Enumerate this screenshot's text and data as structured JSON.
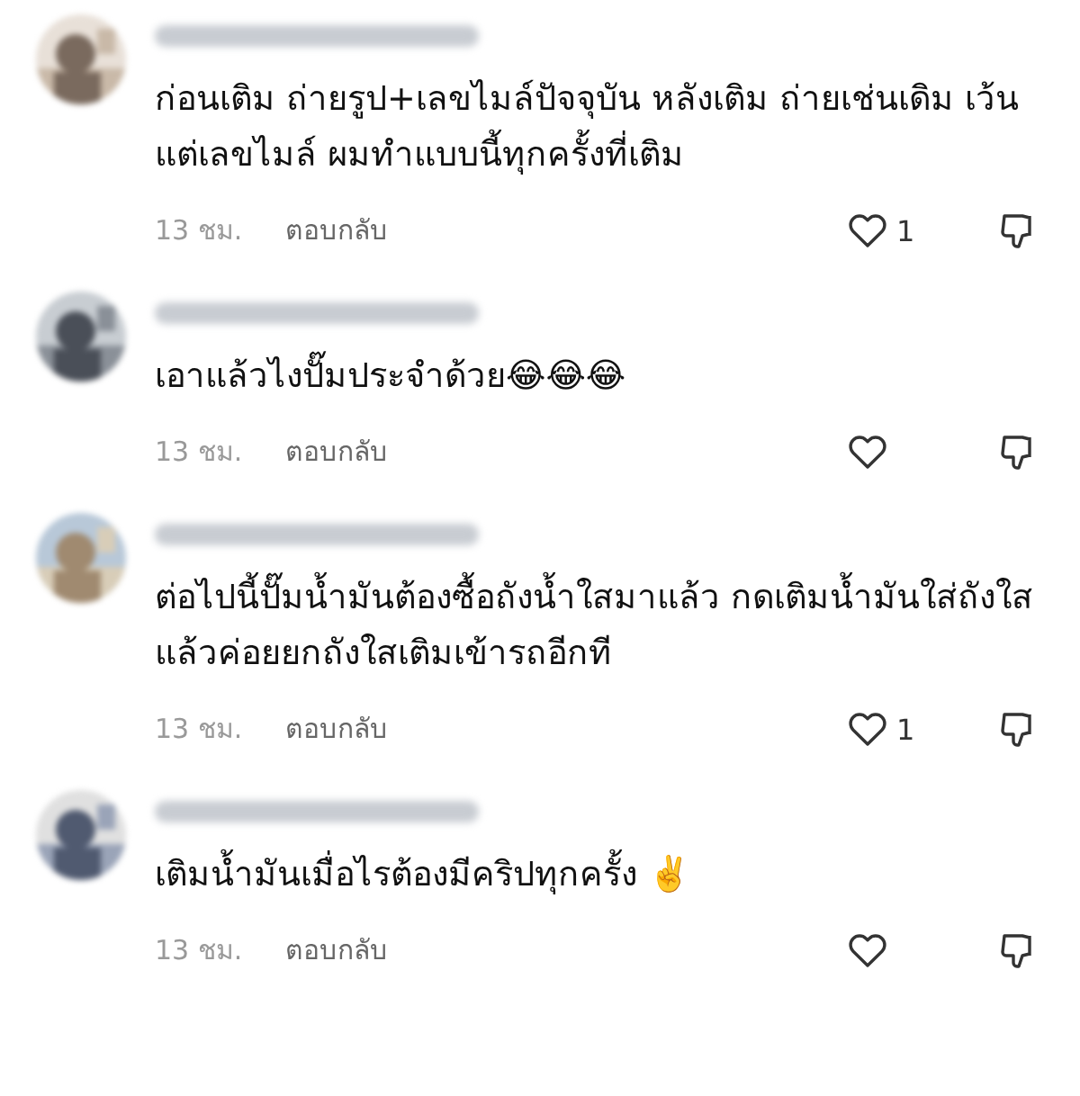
{
  "comments": [
    {
      "text": "ก่อนเติม ถ่ายรูป+เลขไมล์ปัจจุบัน หลังเติม ถ่ายเช่นเดิม เว้นแต่เลขไมล์ ผมทำแบบนี้ทุกครั้งที่เติม",
      "time": "13 ชม.",
      "reply": "ตอบกลับ",
      "likes": "1"
    },
    {
      "text": "เอาแล้วไงปั๊มประจำด้วย😂😂😂",
      "time": "13 ชม.",
      "reply": "ตอบกลับ"
    },
    {
      "text": "ต่อไปนี้ปั๊มน้ำมันต้องซื้อถังน้ำใสมาแล้ว กดเติมน้ำมันใส่ถังใสแล้วค่อยยกถังใสเติมเข้ารถอีกที",
      "time": "13 ชม.",
      "reply": "ตอบกลับ",
      "likes": "1"
    },
    {
      "text": "เติมน้ำมันเมื่อไรต้องมีคริปทุกครั้ง ✌️",
      "time": "13 ชม.",
      "reply": "ตอบกลับ"
    }
  ]
}
